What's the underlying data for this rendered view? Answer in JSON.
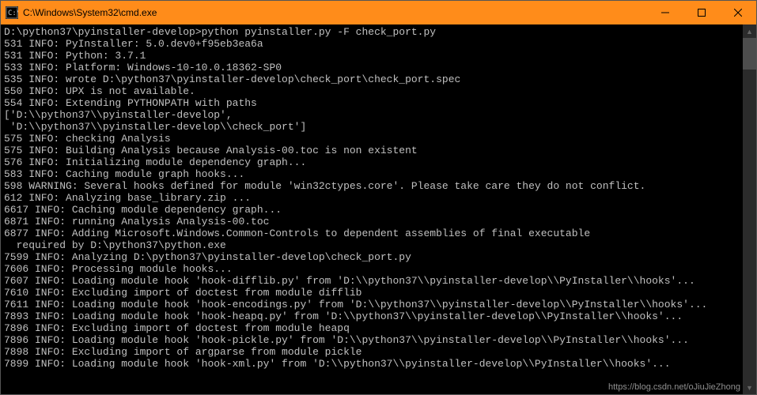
{
  "window": {
    "title": "C:\\Windows\\System32\\cmd.exe"
  },
  "terminal": {
    "lines": [
      "",
      "D:\\python37\\pyinstaller-develop>python pyinstaller.py -F check_port.py",
      "531 INFO: PyInstaller: 5.0.dev0+f95eb3ea6a",
      "531 INFO: Python: 3.7.1",
      "533 INFO: Platform: Windows-10-10.0.18362-SP0",
      "535 INFO: wrote D:\\python37\\pyinstaller-develop\\check_port\\check_port.spec",
      "550 INFO: UPX is not available.",
      "554 INFO: Extending PYTHONPATH with paths",
      "['D:\\\\python37\\\\pyinstaller-develop',",
      " 'D:\\\\python37\\\\pyinstaller-develop\\\\check_port']",
      "575 INFO: checking Analysis",
      "575 INFO: Building Analysis because Analysis-00.toc is non existent",
      "576 INFO: Initializing module dependency graph...",
      "583 INFO: Caching module graph hooks...",
      "598 WARNING: Several hooks defined for module 'win32ctypes.core'. Please take care they do not conflict.",
      "612 INFO: Analyzing base_library.zip ...",
      "6617 INFO: Caching module dependency graph...",
      "6871 INFO: running Analysis Analysis-00.toc",
      "6877 INFO: Adding Microsoft.Windows.Common-Controls to dependent assemblies of final executable",
      "  required by D:\\python37\\python.exe",
      "7599 INFO: Analyzing D:\\python37\\pyinstaller-develop\\check_port.py",
      "7606 INFO: Processing module hooks...",
      "7607 INFO: Loading module hook 'hook-difflib.py' from 'D:\\\\python37\\\\pyinstaller-develop\\\\PyInstaller\\\\hooks'...",
      "7610 INFO: Excluding import of doctest from module difflib",
      "7611 INFO: Loading module hook 'hook-encodings.py' from 'D:\\\\python37\\\\pyinstaller-develop\\\\PyInstaller\\\\hooks'...",
      "7893 INFO: Loading module hook 'hook-heapq.py' from 'D:\\\\python37\\\\pyinstaller-develop\\\\PyInstaller\\\\hooks'...",
      "7896 INFO: Excluding import of doctest from module heapq",
      "7896 INFO: Loading module hook 'hook-pickle.py' from 'D:\\\\python37\\\\pyinstaller-develop\\\\PyInstaller\\\\hooks'...",
      "7898 INFO: Excluding import of argparse from module pickle",
      "7899 INFO: Loading module hook 'hook-xml.py' from 'D:\\\\python37\\\\pyinstaller-develop\\\\PyInstaller\\\\hooks'..."
    ]
  },
  "watermark": "https://blog.csdn.net/oJiuJieZhong"
}
